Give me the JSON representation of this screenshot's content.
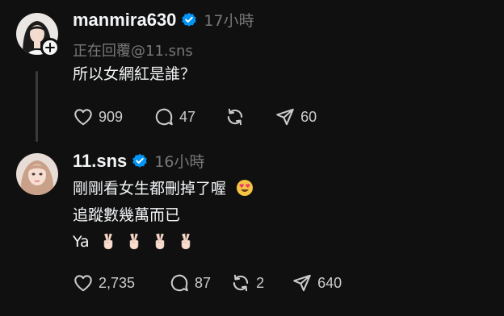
{
  "posts": [
    {
      "username": "manmira630",
      "time": "17小時",
      "reply_to": "正在回覆@11.sns",
      "lines": [
        "所以女網紅是誰？"
      ],
      "likes": "909",
      "replies": "47",
      "reposts": "",
      "shares": "60"
    },
    {
      "username": "11.sns",
      "time": "16小時",
      "lines": [
        "剛剛看女生都刪掉了喔",
        "追蹤數幾萬而已",
        "Ya"
      ],
      "likes": "2,735",
      "replies": "87",
      "reposts": "2",
      "shares": "640"
    }
  ],
  "colors": {
    "background": "#101010",
    "verified": "#0095f6",
    "muted": "#777777"
  },
  "icons": [
    "heart-icon",
    "comment-icon",
    "repost-icon",
    "share-icon",
    "verified-badge-icon",
    "plus-icon",
    "heart-eyes-emoji",
    "victory-hand-emoji"
  ]
}
